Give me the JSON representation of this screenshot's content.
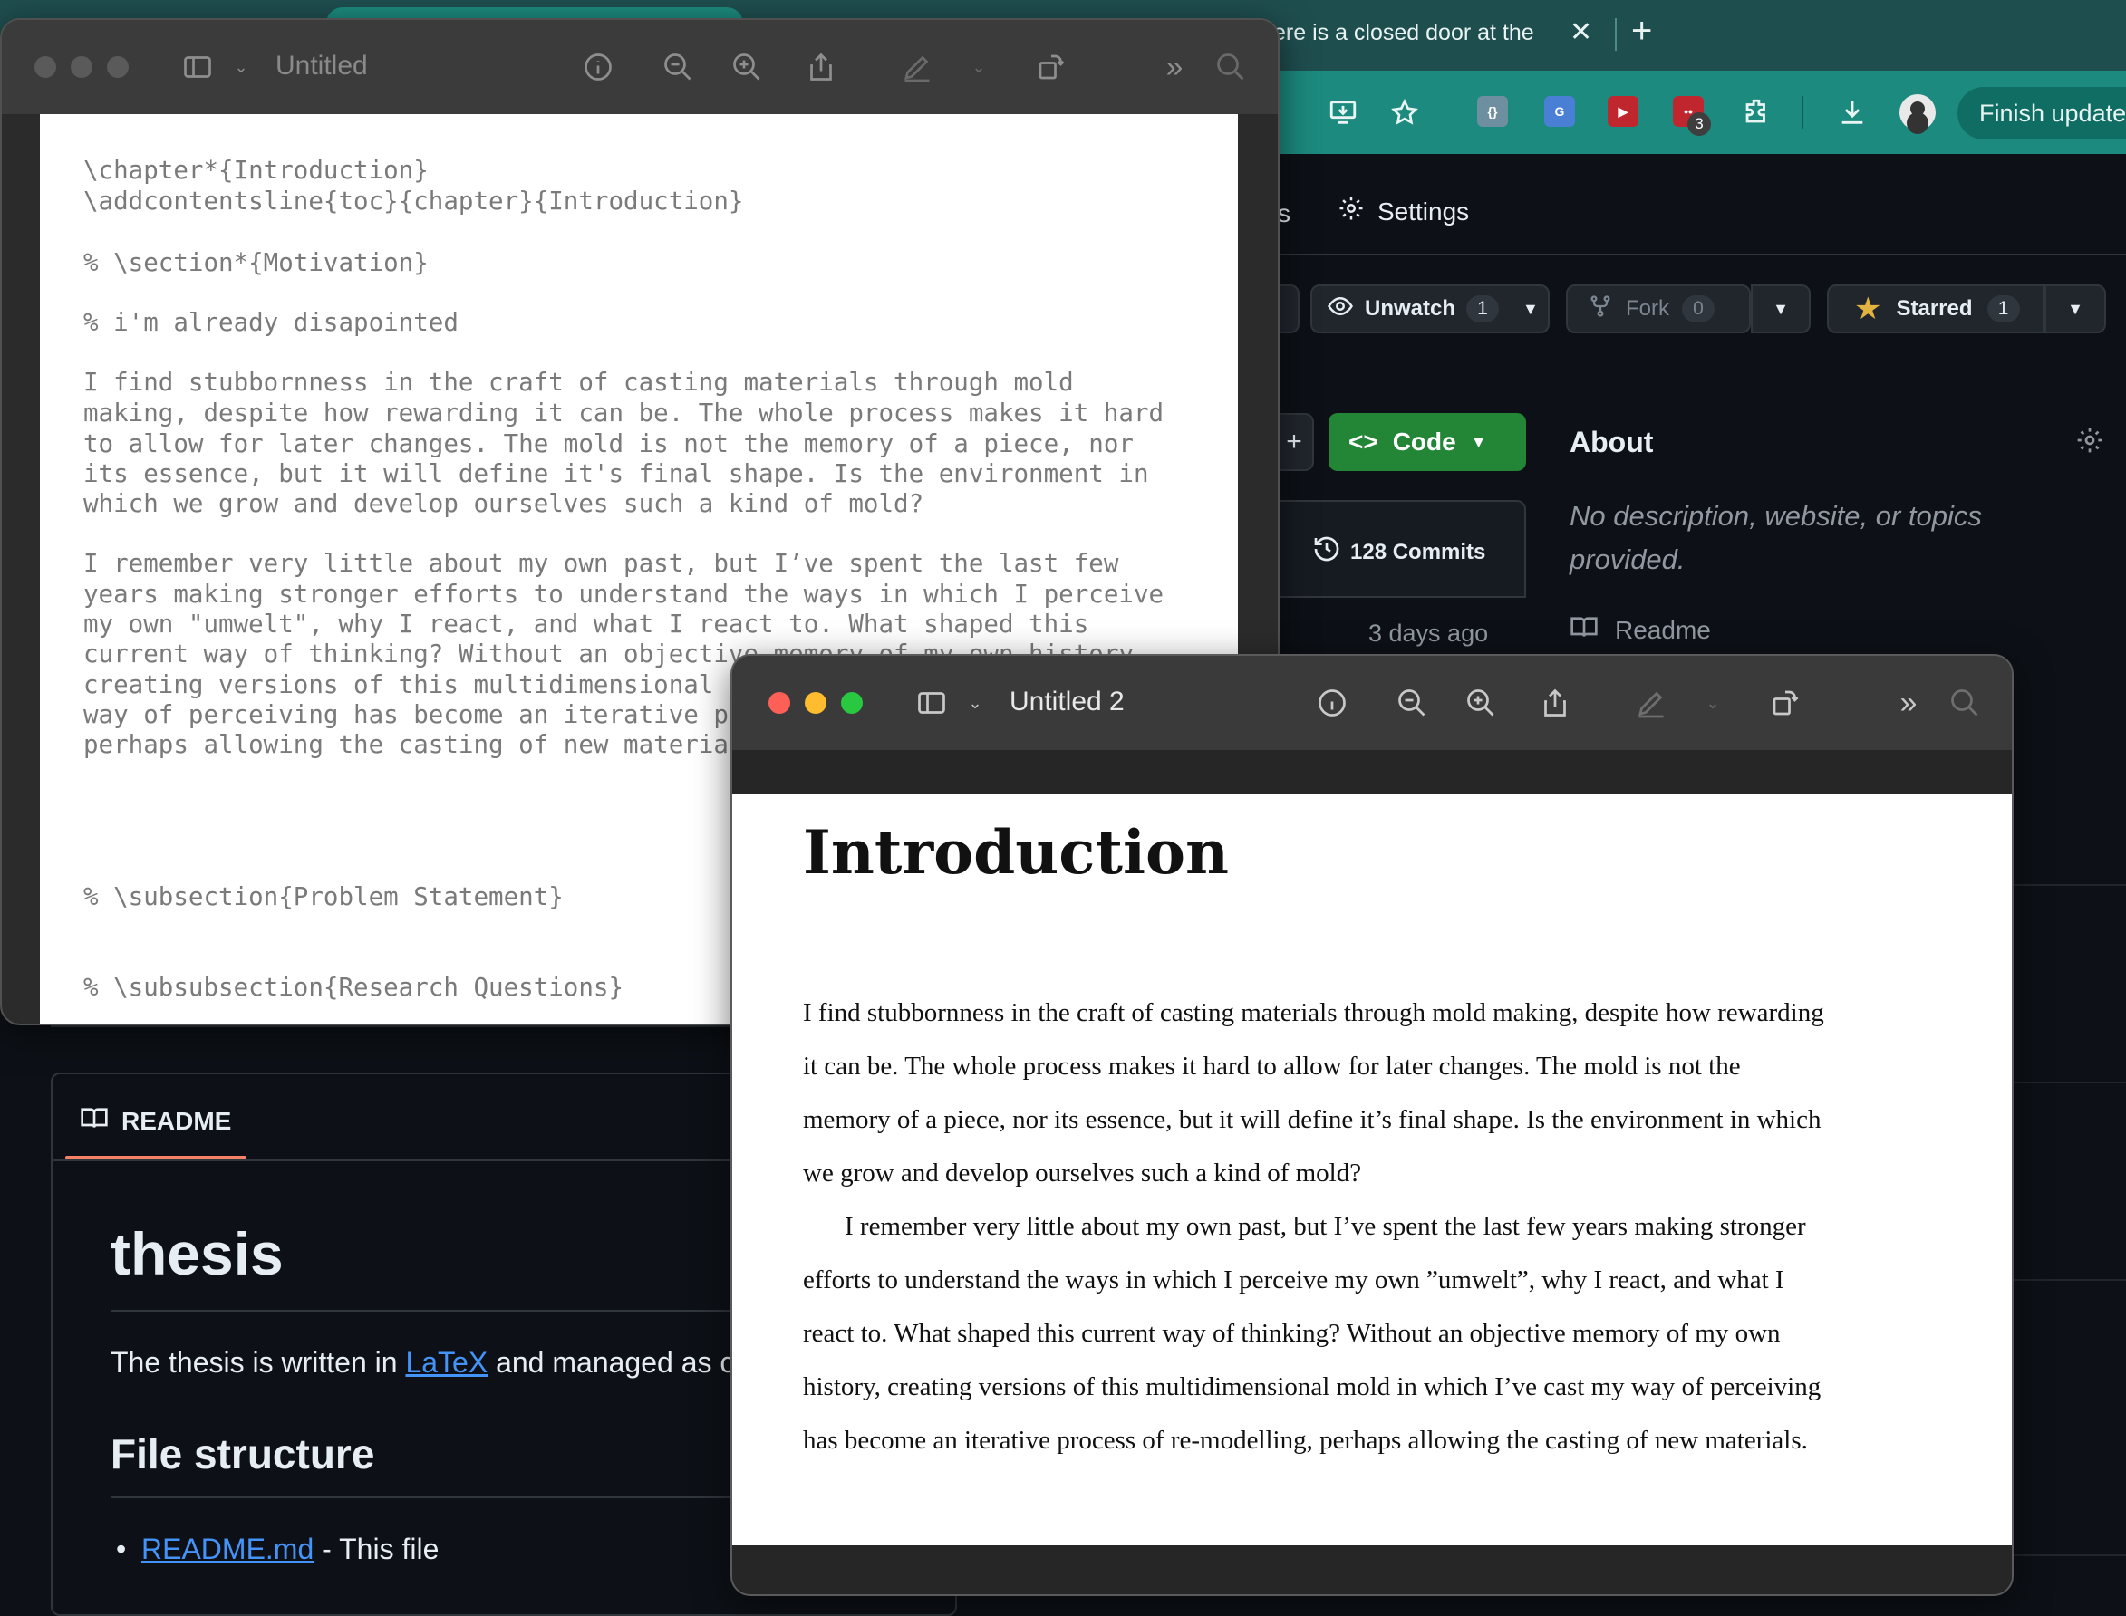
{
  "browser": {
    "tab_title": "ere is a closed door at the",
    "finish_update": "Finish update",
    "extension_badge": "3"
  },
  "github": {
    "nav_partial": "s",
    "settings": "Settings",
    "unwatch": {
      "label": "Unwatch",
      "count": "1"
    },
    "fork": {
      "label": "Fork",
      "count": "0"
    },
    "starred": {
      "label": "Starred",
      "count": "1"
    },
    "code_button": "Code",
    "commits": "128 Commits",
    "days_ago": "3 days ago",
    "about": {
      "title": "About",
      "desc_line1": "No description, website, or topics",
      "desc_line2": "provided.",
      "readme_link": "Readme"
    },
    "readme": {
      "tab": "README",
      "h1": "thesis",
      "p_before": "The thesis is written in ",
      "p_link": "LaTeX",
      "p_after": " and managed as c",
      "h2": "File structure",
      "li_link": "README.md",
      "li_rest": " - This file"
    }
  },
  "editor": {
    "title": "Untitled",
    "lines": [
      "\\chapter*{Introduction}",
      "\\addcontentsline{toc}{chapter}{Introduction}",
      "% \\section*{Motivation}",
      "% i'm already disapointed",
      "I find stubbornness in the craft of casting materials through mold",
      "making, despite how rewarding it can be. The whole process makes it hard",
      "to allow for later changes. The mold is not the memory of a piece, nor",
      "its essence, but it will define it's final shape. Is the environment in",
      "which we grow and develop ourselves such a kind of mold?",
      "I remember very little about my own past, but I’ve spent the last few",
      "years making stronger efforts to understand the ways in which I perceive",
      "my own \"umwelt\", why I react, and what I react to. What shaped this",
      "current way of thinking? Without an objective memory of my own history,",
      "creating versions of this multidimensional mold in which I’ve cast my",
      "way of perceiving has become an iterative process of re-modelling,",
      "perhaps allowing the casting of new materials.",
      "% \\subsection{Problem Statement}",
      "% \\subsubsection{Research Questions}"
    ]
  },
  "preview": {
    "title": "Untitled 2",
    "heading": "Introduction",
    "lines": [
      "I find stubbornness in the craft of casting materials through mold making, despite how rewarding",
      "it can be.  The whole process makes it hard to allow for later changes.  The mold is not the",
      "memory of a piece, nor its essence, but it will define it’s final shape. Is the environment in which",
      "we grow and develop ourselves such a kind of mold?",
      "I remember very little about my own past, but I’ve spent the last few years making stronger",
      "efforts to understand the ways in which I perceive my own ”umwelt”, why I react, and what I",
      "react to.  What shaped this current way of thinking?  Without an objective memory of my own",
      "history, creating versions of this multidimensional mold in which I’ve cast my way of perceiving",
      "has become an iterative process of re-modelling, perhaps allowing the casting of new materials."
    ]
  },
  "colors": {
    "traffic_red": "#fe5f57",
    "traffic_yellow": "#febc2e",
    "traffic_green": "#28c840",
    "gh_green": "#238636",
    "browser_toolbar": "#1c8a7e"
  }
}
